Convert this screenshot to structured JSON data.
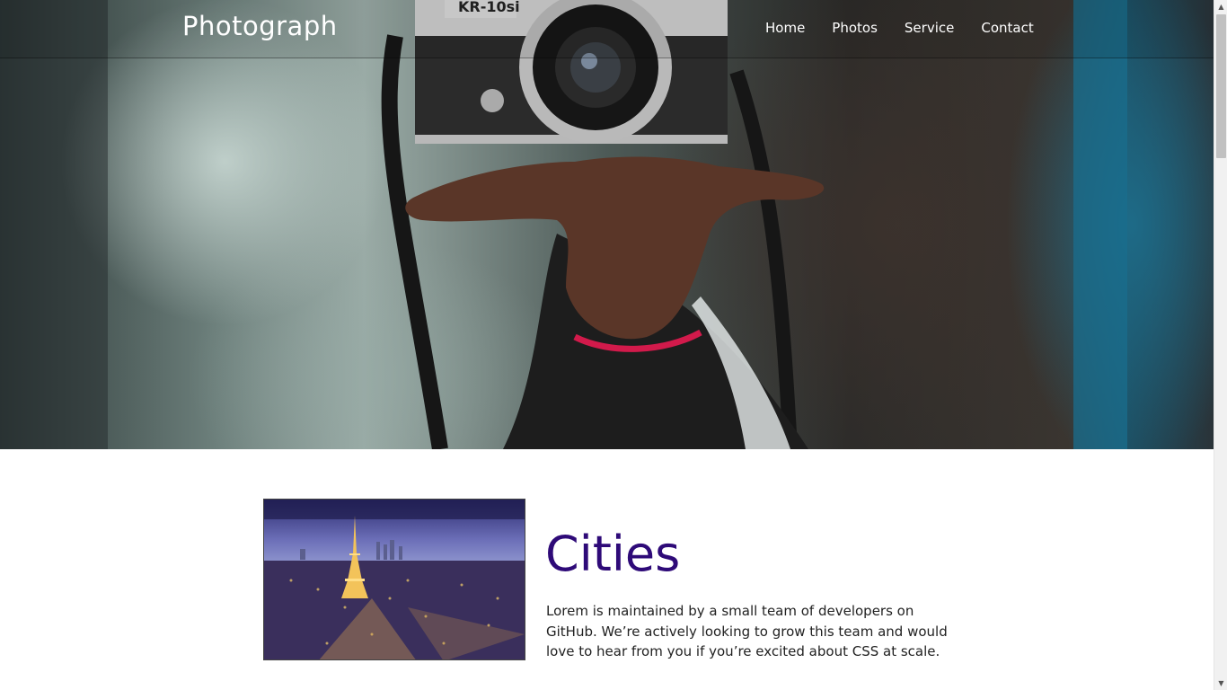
{
  "header": {
    "brand": "Photograph",
    "nav": [
      {
        "label": "Home"
      },
      {
        "label": "Photos"
      },
      {
        "label": "Service"
      },
      {
        "label": "Contact"
      }
    ]
  },
  "hero": {
    "image": "camera-hand-hero-photo",
    "camera_text": "KR-10si"
  },
  "feature": {
    "image": "paris-eiffel-tower-night-photo",
    "title": "Cities",
    "body": "Lorem is maintained by a small team of developers on GitHub. We’re actively looking to grow this team and would love to hear from you if you’re excited about CSS at scale."
  },
  "colors": {
    "title": "#2e0a78",
    "nav_text": "#ffffff",
    "body_text": "#222222"
  }
}
